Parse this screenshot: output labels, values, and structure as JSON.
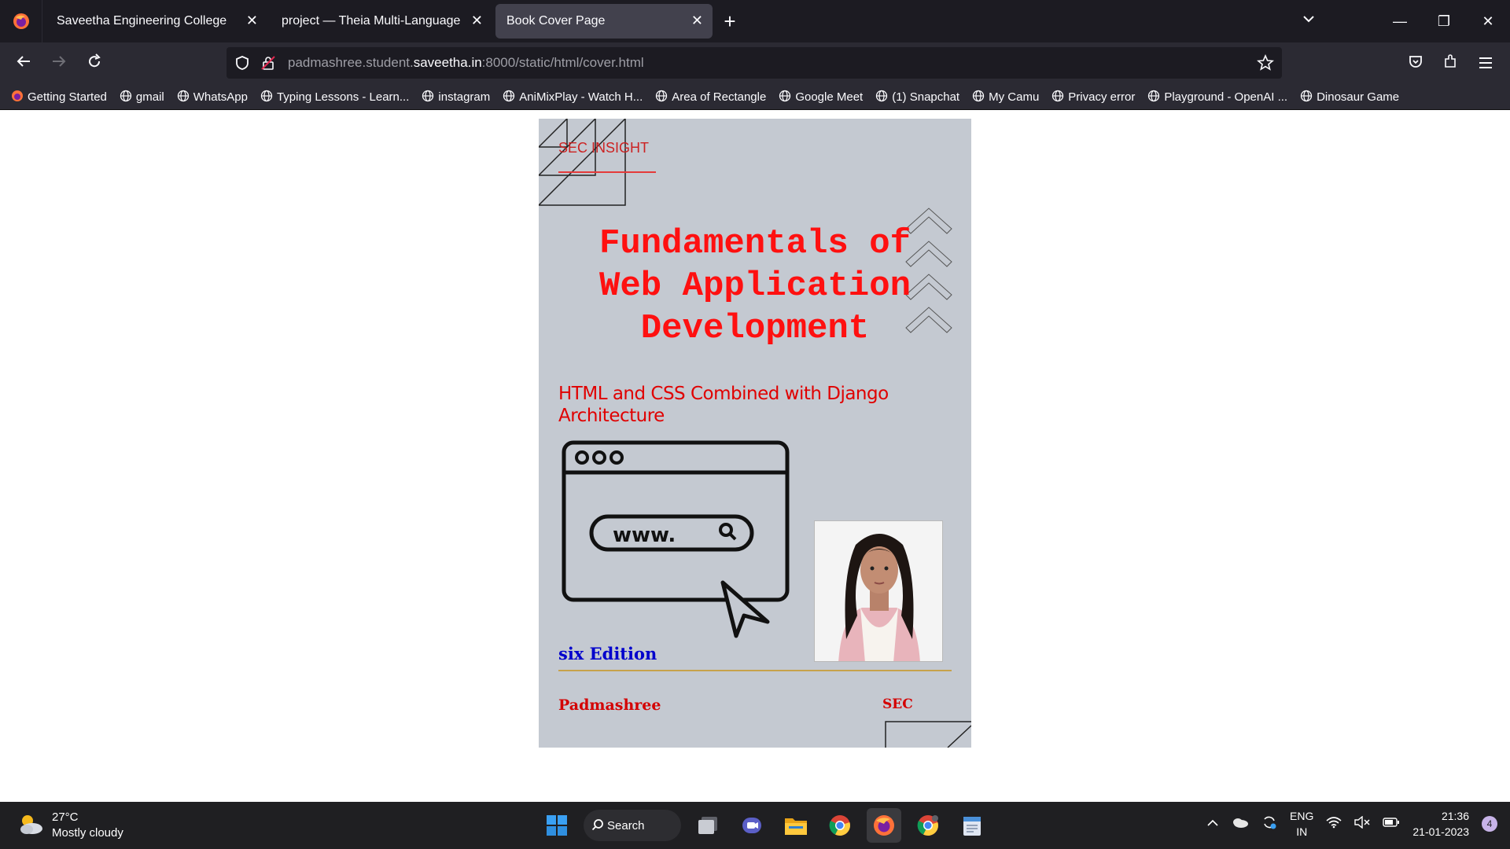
{
  "tabs": [
    {
      "title": "Saveetha Engineering College"
    },
    {
      "title": "project — Theia Multi-Language Explorer"
    },
    {
      "title": "Book Cover Page"
    }
  ],
  "url": {
    "prefix": "padmashree.student.",
    "domain": "saveetha.in",
    "suffix": ":8000/static/html/cover.html"
  },
  "bookmarks": [
    {
      "label": "Getting Started"
    },
    {
      "label": "gmail"
    },
    {
      "label": "WhatsApp"
    },
    {
      "label": "Typing Lessons - Learn..."
    },
    {
      "label": "instagram"
    },
    {
      "label": "AniMixPlay - Watch H..."
    },
    {
      "label": "Area of Rectangle"
    },
    {
      "label": "Google Meet"
    },
    {
      "label": "(1) Snapchat"
    },
    {
      "label": "My Camu"
    },
    {
      "label": "Privacy error"
    },
    {
      "label": "Playground - OpenAI ..."
    },
    {
      "label": "Dinosaur Game"
    }
  ],
  "cover": {
    "brand": "SEC INSIGHT",
    "title_lines": [
      "Fundamentals of",
      "Web Application",
      "Development"
    ],
    "subtitle": "HTML and CSS Combined with Django Architecture",
    "web_text": "www.",
    "edition": "six Edition",
    "author": "Padmashree",
    "publisher": "SEC"
  },
  "taskbar": {
    "temperature": "27°C",
    "weather": "Mostly cloudy",
    "search_label": "Search",
    "lang_top": "ENG",
    "lang_bottom": "IN",
    "time": "21:36",
    "date": "21-01-2023",
    "notifications": "4"
  },
  "colors": {
    "title": "#ff1010",
    "cover_bg": "#c4c9d1",
    "edition": "#0000cc",
    "browser_bg": "#1c1b22"
  }
}
